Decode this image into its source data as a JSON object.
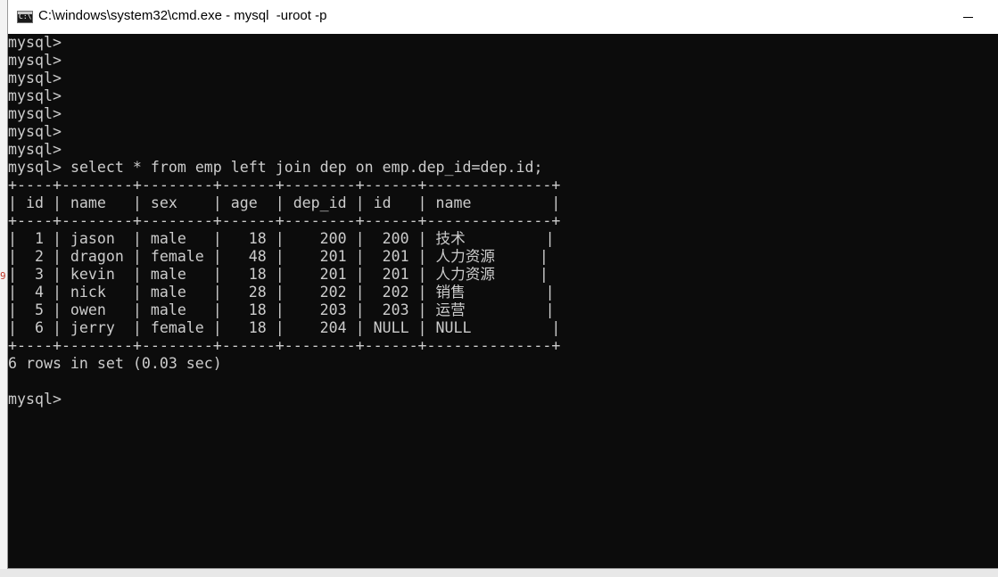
{
  "window": {
    "title": "C:\\windows\\system32\\cmd.exe - mysql  -uroot -p",
    "icon": "cmd-icon",
    "minimize_icon": "minimize-icon"
  },
  "console": {
    "prompt": "mysql>",
    "empty_prompts": [
      "mysql>",
      "mysql>",
      "mysql>",
      "mysql>",
      "mysql>",
      "mysql>",
      "mysql>"
    ],
    "command": "select * from emp left join dep on emp.dep_id=dep.id;",
    "table": {
      "separator": "+----+--------+--------+------+--------+------+--------------+",
      "header": "| id | name   | sex    | age  | dep_id | id   | name         |",
      "rows": [
        "|  1 | jason  | male   |   18 |    200 |  200 | 技术         |",
        "|  2 | dragon | female |   48 |    201 |  201 | 人力资源     |",
        "|  3 | kevin  | male   |   18 |    201 |  201 | 人力资源     |",
        "|  4 | nick   | male   |   28 |    202 |  202 | 销售         |",
        "|  5 | owen   | male   |   18 |    203 |  203 | 运营         |",
        "|  6 | jerry  | female |   18 |    204 | NULL | NULL         |"
      ],
      "columns": [
        "id",
        "name",
        "sex",
        "age",
        "dep_id",
        "id",
        "name"
      ],
      "data": [
        [
          1,
          "jason",
          "male",
          18,
          200,
          200,
          "技术"
        ],
        [
          2,
          "dragon",
          "female",
          48,
          201,
          201,
          "人力资源"
        ],
        [
          3,
          "kevin",
          "male",
          18,
          201,
          201,
          "人力资源"
        ],
        [
          4,
          "nick",
          "male",
          28,
          202,
          202,
          "销售"
        ],
        [
          5,
          "owen",
          "male",
          18,
          203,
          203,
          "运营"
        ],
        [
          6,
          "jerry",
          "female",
          18,
          204,
          "NULL",
          "NULL"
        ]
      ]
    },
    "result_summary": "6 rows in set (0.03 sec)",
    "final_prompt": "mysql>"
  },
  "colors": {
    "console_bg": "#0c0c0c",
    "console_fg": "#cccccc",
    "titlebar_bg": "#ffffff"
  }
}
